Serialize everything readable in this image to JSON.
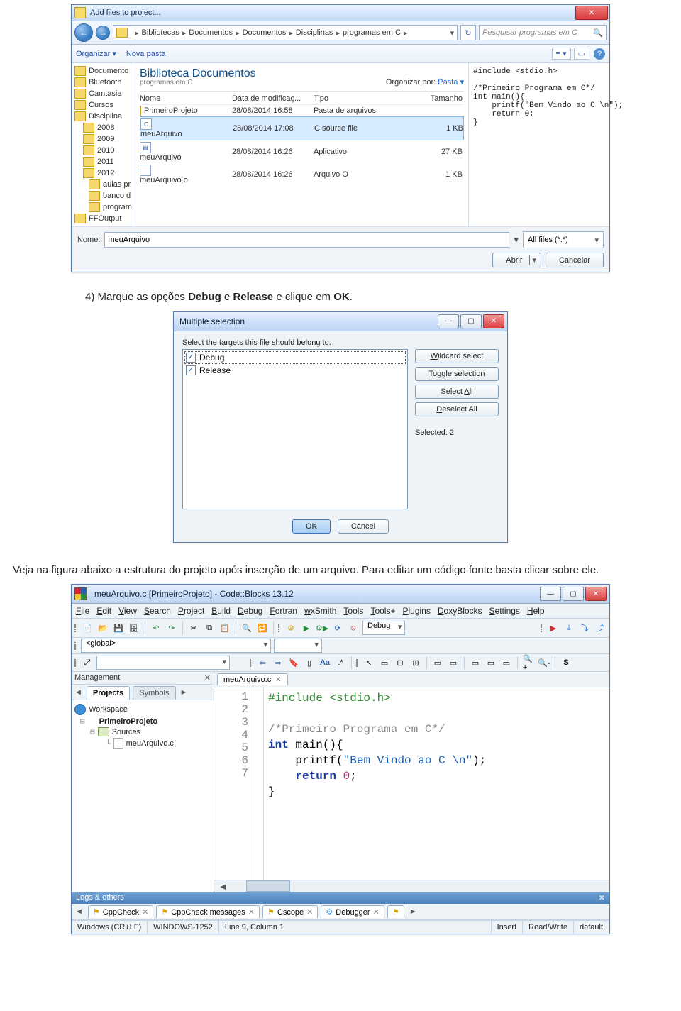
{
  "sc1": {
    "title": "Add files to project...",
    "breadcrumb": [
      "Bibliotecas",
      "Documentos",
      "Documentos",
      "Disciplinas",
      "programas em C"
    ],
    "search_placeholder": "Pesquisar programas em C",
    "toolbar": {
      "organizar": "Organizar",
      "nova_pasta": "Nova pasta"
    },
    "tree": [
      "Documento",
      "Bluetooth",
      "Camtasia",
      "Cursos",
      "Disciplina",
      "2008",
      "2009",
      "2010",
      "2011",
      "2012",
      "aulas pr",
      "banco d",
      "program",
      "FFOutput"
    ],
    "library": {
      "title": "Biblioteca Documentos",
      "subtitle": "programas em C",
      "organizar_por": "Organizar por:",
      "pasta": "Pasta"
    },
    "columns": {
      "name": "Nome",
      "date": "Data de modificaç...",
      "type": "Tipo",
      "size": "Tamanho"
    },
    "rows": [
      {
        "name": "PrimeiroProjeto",
        "date": "28/08/2014 16:58",
        "type": "Pasta de arquivos",
        "size": ""
      },
      {
        "name": "meuArquivo",
        "date": "28/08/2014 17:08",
        "type": "C source file",
        "size": "1 KB"
      },
      {
        "name": "meuArquivo",
        "date": "28/08/2014 16:26",
        "type": "Aplicativo",
        "size": "27 KB"
      },
      {
        "name": "meuArquivo.o",
        "date": "28/08/2014 16:26",
        "type": "Arquivo O",
        "size": "1 KB"
      }
    ],
    "preview": "#include <stdio.h>\n\n/*Primeiro Programa em C*/\nint main(){\n    printf(\"Bem Vindo ao C \\n\");\n    return 0;\n}",
    "footer": {
      "nome_label": "Nome:",
      "nome_value": "meuArquivo",
      "filter": "All files (*.*)",
      "abrir": "Abrir",
      "cancelar": "Cancelar"
    }
  },
  "text1": "4)  Marque as opções ",
  "text1b1": "Debug",
  "text1m": " e ",
  "text1b2": "Release",
  "text1e": " e clique em ",
  "text1b3": "OK",
  "text1dot": ".",
  "sc2": {
    "title": "Multiple selection",
    "prompt": "Select the targets this file should belong to:",
    "items": [
      "Debug",
      "Release"
    ],
    "b_wildcard": "Wildcard select",
    "b_toggle": "Toggle selection",
    "b_selectall": "Select All",
    "b_deselect": "Deselect All",
    "selected": "Selected: 2",
    "ok": "OK",
    "cancel": "Cancel"
  },
  "text2a": "Veja na figura abaixo a estrutura do projeto após inserção de um arquivo. Para editar um código fonte basta clicar sobre ele.",
  "sc3": {
    "title": "meuArquivo.c [PrimeiroProjeto] - Code::Blocks 13.12",
    "menus": [
      "File",
      "Edit",
      "View",
      "Search",
      "Project",
      "Build",
      "Debug",
      "Fortran",
      "wxSmith",
      "Tools",
      "Tools+",
      "Plugins",
      "DoxyBlocks",
      "Settings",
      "Help"
    ],
    "build_target": "Debug",
    "global": "<global>",
    "management": "Management",
    "tabs": {
      "projects": "Projects",
      "symbols": "Symbols"
    },
    "tree": {
      "workspace": "Workspace",
      "project": "PrimeiroProjeto",
      "sources": "Sources",
      "file": "meuArquivo.c"
    },
    "editor_tab": "meuArquivo.c",
    "code": {
      "l1_pp": "#include ",
      "l1_inc": "<stdio.h>",
      "l3_cm": "/*Primeiro Programa em C*/",
      "l4_kw": "int",
      "l4_rest": " main(){",
      "l5_a": "    printf(",
      "l5_str": "\"Bem Vindo ao C \\n\"",
      "l5_b": ");",
      "l6_kw": "    return",
      "l6_num": " 0",
      "l6_b": ";",
      "l7": "}"
    },
    "logs_header": "Logs & others",
    "logtabs": [
      "CppCheck",
      "CppCheck messages",
      "Cscope",
      "Debugger"
    ],
    "status": {
      "eol": "Windows (CR+LF)",
      "enc": "WINDOWS-1252",
      "pos": "Line 9, Column 1",
      "ins": "Insert",
      "rw": "Read/Write",
      "prof": "default"
    }
  }
}
